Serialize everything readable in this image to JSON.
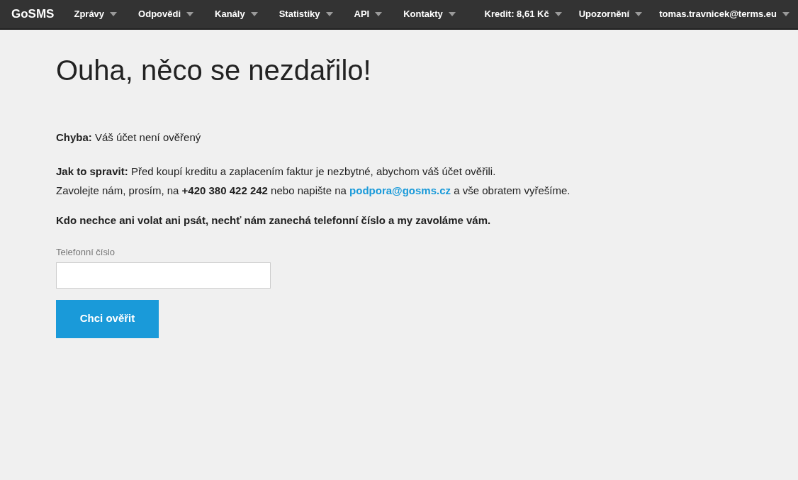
{
  "navbar": {
    "logo": "GoSMS",
    "menus": [
      {
        "label": "Zprávy"
      },
      {
        "label": "Odpovědi"
      },
      {
        "label": "Kanály"
      },
      {
        "label": "Statistiky"
      },
      {
        "label": "API"
      },
      {
        "label": "Kontakty"
      }
    ],
    "right_menus": [
      {
        "label": "Kredit: 8,61 Kč"
      },
      {
        "label": "Upozornění"
      },
      {
        "label": "tomas.travnicek@terms.eu"
      }
    ]
  },
  "heading": "Ouha, něco se nezdařilo!",
  "error": "**Chyba:** Váš účet není ověřený",
  "fix": "**Jak to spravit:** Před koupí kreditu a zaplacením faktur je nezbytné, abychom váš účet ověřili.",
  "contact": {
    "before_link": "Zavolejte nám, prosím, na **+420 380 422 242** nebo napište na",
    "link": "podpora@gosms.cz",
    "after_link": "a vše obratem vyřešíme."
  },
  "callback_note": "Kdo nechce ani volat ani psát, nechť nám zanechá telefonní číslo a my zavoláme vám.",
  "phone_field": {
    "label": "Telefonní číslo"
  },
  "submit_button": "Chci ověřit"
}
